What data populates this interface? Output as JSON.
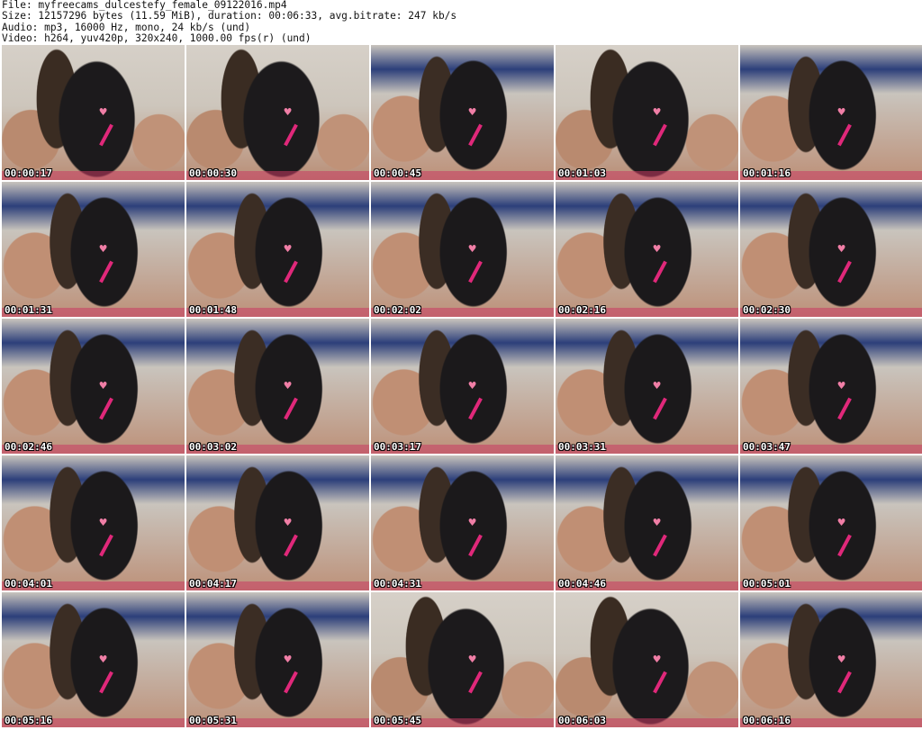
{
  "header": {
    "file_line": "File: myfreecams_dulcestefy_female_09122016.mp4",
    "size_line": "Size: 12157296 bytes (11.59 MiB), duration: 00:06:33, avg.bitrate: 247 kb/s",
    "audio_line": "Audio: mp3, 16000 Hz, mono, 24 kb/s (und)",
    "video_line": "Video: h264, yuv420p, 320x240, 1000.00 fps(r) (und)"
  },
  "thumbnails": [
    {
      "timestamp": "00:00:17"
    },
    {
      "timestamp": "00:00:30"
    },
    {
      "timestamp": "00:00:45"
    },
    {
      "timestamp": "00:01:03"
    },
    {
      "timestamp": "00:01:16"
    },
    {
      "timestamp": "00:01:31"
    },
    {
      "timestamp": "00:01:48"
    },
    {
      "timestamp": "00:02:02"
    },
    {
      "timestamp": "00:02:16"
    },
    {
      "timestamp": "00:02:30"
    },
    {
      "timestamp": "00:02:46"
    },
    {
      "timestamp": "00:03:02"
    },
    {
      "timestamp": "00:03:17"
    },
    {
      "timestamp": "00:03:31"
    },
    {
      "timestamp": "00:03:47"
    },
    {
      "timestamp": "00:04:01"
    },
    {
      "timestamp": "00:04:17"
    },
    {
      "timestamp": "00:04:31"
    },
    {
      "timestamp": "00:04:46"
    },
    {
      "timestamp": "00:05:01"
    },
    {
      "timestamp": "00:05:16"
    },
    {
      "timestamp": "00:05:31"
    },
    {
      "timestamp": "00:05:45"
    },
    {
      "timestamp": "00:06:03"
    },
    {
      "timestamp": "00:06:16"
    }
  ]
}
